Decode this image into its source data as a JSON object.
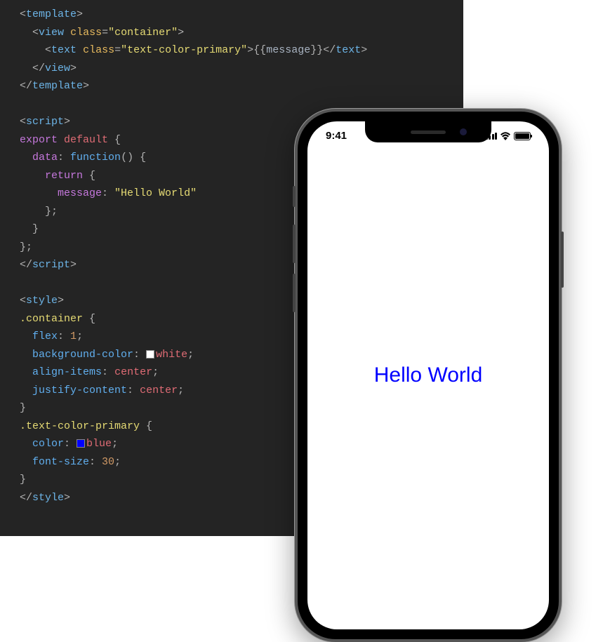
{
  "code": {
    "line1_open": "<",
    "line1_tag": "template",
    "line1_close": ">",
    "line2_open": "<",
    "line2_tag": "view",
    "line2_sp": " ",
    "line2_attr": "class",
    "line2_eq": "=",
    "line2_q1": "\"",
    "line2_val": "container",
    "line2_q2": "\"",
    "line2_close": ">",
    "line3_open": "<",
    "line3_tag": "text",
    "line3_sp": " ",
    "line3_attr": "class",
    "line3_eq": "=",
    "line3_q1": "\"",
    "line3_val": "text-color-primary",
    "line3_q2": "\"",
    "line3_close": ">",
    "line3_mustache": "{{",
    "line3_var": "message",
    "line3_mustache2": "}}",
    "line3_endopen": "</",
    "line3_endtag": "text",
    "line3_endclose": ">",
    "line4_open": "</",
    "line4_tag": "view",
    "line4_close": ">",
    "line5_open": "</",
    "line5_tag": "template",
    "line5_close": ">",
    "line7_open": "<",
    "line7_tag": "script",
    "line7_close": ">",
    "line8_export": "export",
    "line8_default": " default ",
    "line8_brace": "{",
    "line9_key": "data",
    "line9_colon": ": ",
    "line9_func": "function",
    "line9_parens": "() {",
    "line10_return": "return",
    "line10_brace": " {",
    "line11_key": "message",
    "line11_colon": ": ",
    "line11_str": "\"Hello World\"",
    "line12_close": "};",
    "line13_close": "}",
    "line14_close": "};",
    "line15_open": "</",
    "line15_tag": "script",
    "line15_close": ">",
    "line17_open": "<",
    "line17_tag": "style",
    "line17_close": ">",
    "line18_sel": ".container",
    "line18_brace": " {",
    "line19_prop": "flex",
    "line19_colon": ": ",
    "line19_val": "1",
    "line19_semi": ";",
    "line20_prop": "background-color",
    "line20_colon": ": ",
    "line20_val": "white",
    "line20_semi": ";",
    "line21_prop": "align-items",
    "line21_colon": ": ",
    "line21_val": "center",
    "line21_semi": ";",
    "line22_prop": "justify-content",
    "line22_colon": ": ",
    "line22_val": "center",
    "line22_semi": ";",
    "line23_close": "}",
    "line24_sel": ".text-color-primary",
    "line24_brace": " {",
    "line25_prop": "color",
    "line25_colon": ": ",
    "line25_val": "blue",
    "line25_semi": ";",
    "line26_prop": "font-size",
    "line26_colon": ": ",
    "line26_val": "30",
    "line26_semi": ";",
    "line27_close": "}",
    "line28_open": "</",
    "line28_tag": "style",
    "line28_close": ">"
  },
  "phone": {
    "time": "9:41",
    "message": "Hello World"
  }
}
